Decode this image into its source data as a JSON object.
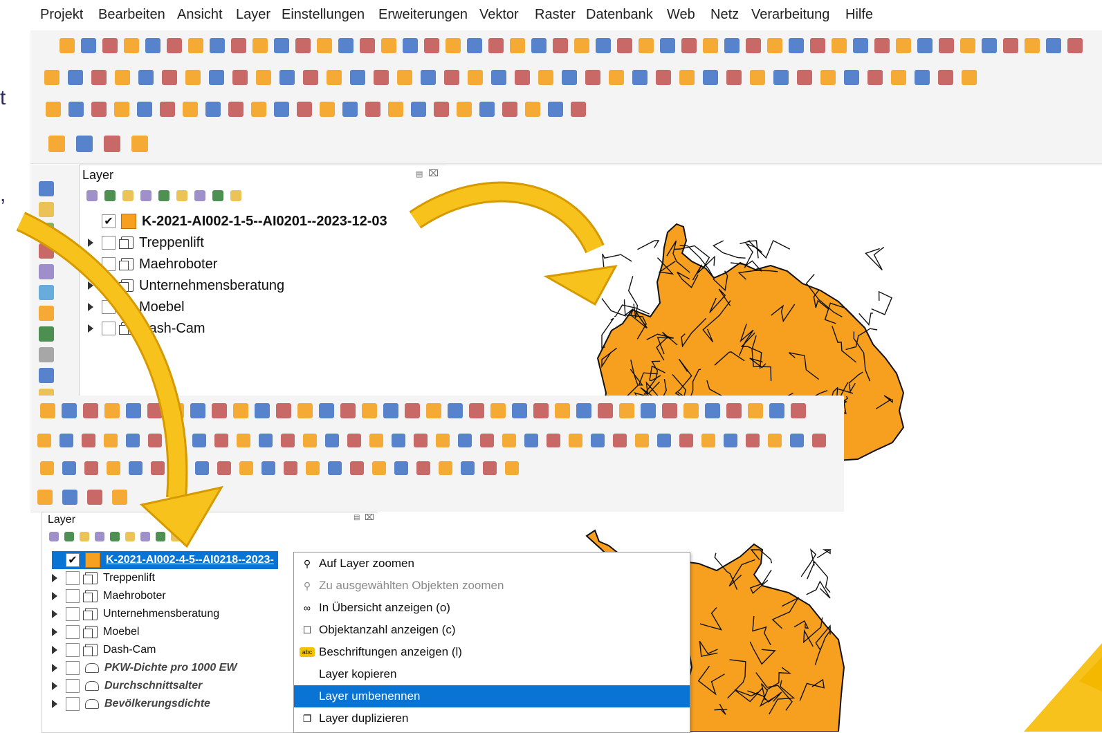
{
  "menubar": {
    "items": [
      "Projekt",
      "Bearbeiten",
      "Ansicht",
      "Layer",
      "Einstellungen",
      "Erweiterungen",
      "Vektor",
      "Raster",
      "Datenbank",
      "Web",
      "Netz",
      "Verarbeitung",
      "Hilfe"
    ]
  },
  "left_text": {
    "t1": "t",
    "t2": ","
  },
  "top_panel": {
    "title": "Layer",
    "layers": [
      {
        "label": "K-2021-AI002-1-5--AI0201--2023-12-03",
        "checked": true,
        "type": "vector"
      },
      {
        "label": "Treppenlift",
        "checked": false,
        "type": "group"
      },
      {
        "label": "Maehroboter",
        "checked": false,
        "type": "group"
      },
      {
        "label": "Unternehmensberatung",
        "checked": false,
        "type": "group"
      },
      {
        "label": "Moebel",
        "checked": false,
        "type": "group"
      },
      {
        "label": "Dash-Cam",
        "checked": false,
        "type": "group"
      }
    ]
  },
  "bottom_panel": {
    "title": "Layer",
    "layers": [
      {
        "label": "K-2021-AI002-4-5--AI0218--2023-",
        "checked": true,
        "type": "vector",
        "selected": true
      },
      {
        "label": "Treppenlift",
        "checked": false,
        "type": "group"
      },
      {
        "label": "Maehroboter",
        "checked": false,
        "type": "group"
      },
      {
        "label": "Unternehmensberatung",
        "checked": false,
        "type": "group"
      },
      {
        "label": "Moebel",
        "checked": false,
        "type": "group"
      },
      {
        "label": "Dash-Cam",
        "checked": false,
        "type": "group"
      },
      {
        "label": "PKW-Dichte pro 1000 EW",
        "checked": false,
        "type": "raster"
      },
      {
        "label": "Durchschnittsalter",
        "checked": false,
        "type": "raster"
      },
      {
        "label": "Bevölkerungsdichte",
        "checked": false,
        "type": "raster"
      }
    ]
  },
  "context_menu": {
    "items": [
      {
        "label": "Auf Layer zoomen",
        "icon": "zoom-layer-icon",
        "enabled": true,
        "highlighted": false
      },
      {
        "label": "Zu ausgewählten Objekten zoomen",
        "icon": "zoom-selection-icon",
        "enabled": false,
        "highlighted": false
      },
      {
        "label": "In Übersicht anzeigen (o)",
        "icon": "overview-icon",
        "enabled": true,
        "highlighted": false
      },
      {
        "label": "Objektanzahl anzeigen (c)",
        "icon": "checkbox-icon",
        "enabled": true,
        "highlighted": false
      },
      {
        "label": "Beschriftungen anzeigen (l)",
        "icon": "labels-icon",
        "enabled": true,
        "highlighted": false
      },
      {
        "label": "Layer kopieren",
        "icon": "",
        "enabled": true,
        "highlighted": false
      },
      {
        "label": "Layer umbenennen",
        "icon": "",
        "enabled": true,
        "highlighted": true
      },
      {
        "label": "Layer duplizieren",
        "icon": "duplicate-icon",
        "enabled": true,
        "highlighted": false
      }
    ]
  },
  "colors": {
    "accent": "#f5b800",
    "map_fill": "#f7a020",
    "selection": "#0a74d4"
  }
}
